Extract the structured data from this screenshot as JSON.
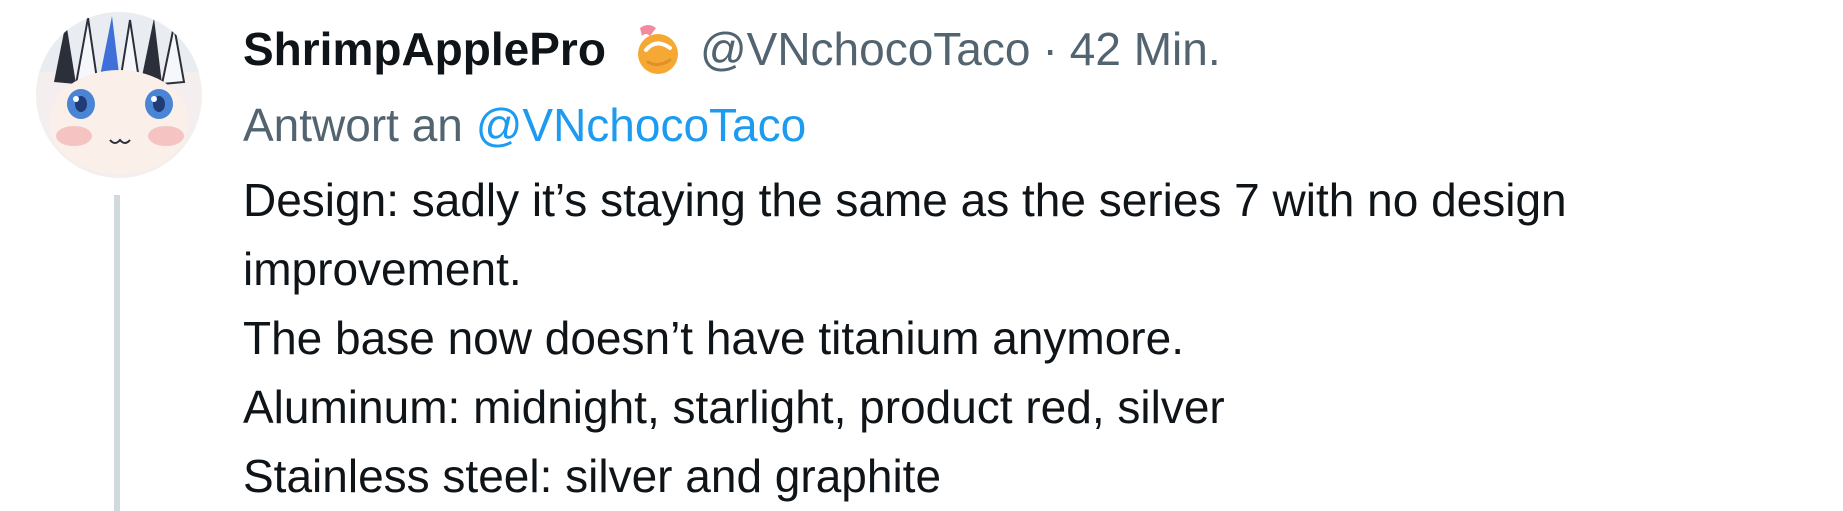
{
  "tweet": {
    "author": {
      "display_name": "ShrimpApplePro",
      "name_emoji": "shrimp-emoji",
      "handle": "@VNchocoTaco",
      "separator": "·",
      "time": "42 Min."
    },
    "reply": {
      "prefix": "Antwort an ",
      "mention": "@VNchocoTaco"
    },
    "body": [
      "Design: sadly it’s staying the same as the series 7 with no design",
      "improvement.",
      "The base now doesn’t have titanium anymore.",
      "Aluminum: midnight, starlight, product red, silver",
      "Stainless steel: silver and graphite"
    ]
  },
  "colors": {
    "text": "#0f1419",
    "secondary": "#536471",
    "link": "#1d9bf0",
    "thread_line": "#cfd9de"
  }
}
